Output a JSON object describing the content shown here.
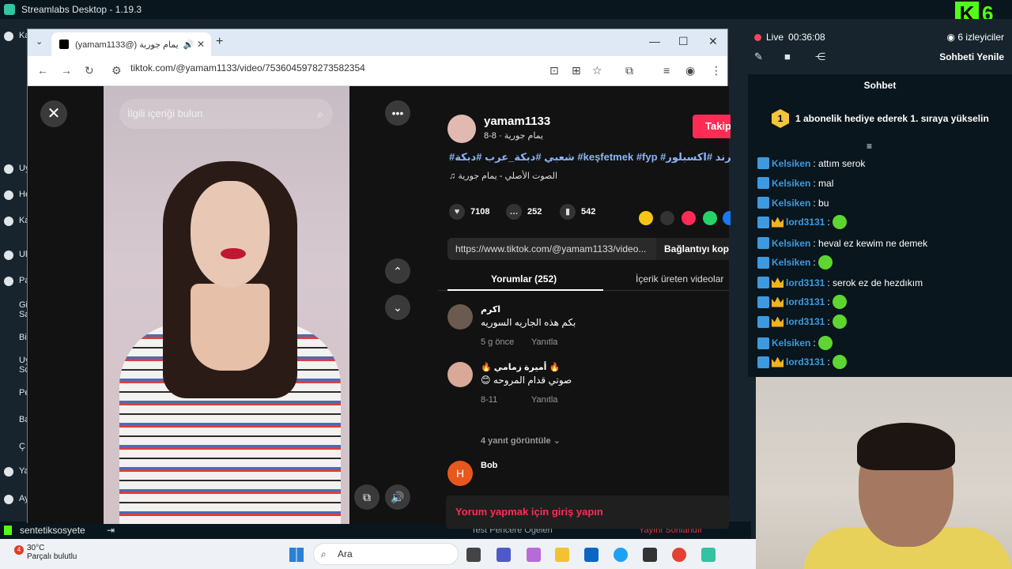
{
  "app_title": "Streamlabs Desktop - 1.19.3",
  "kick_badge": "6",
  "left_nav": [
    "Ka",
    "Uy",
    "He",
    "Ka",
    "Ul",
    "Pa",
    "Gi Sa",
    "Bi",
    "Uy Sc",
    "Pe",
    "Ba",
    "Ç",
    "Ya",
    "Ay"
  ],
  "bottom": {
    "user": "sentetiksosyete",
    "test_windows": "Test Pencere Öğeleri",
    "end_stream": "Yayını Sonlandır"
  },
  "browser": {
    "tab_title": "(yamam1133@) يمام جورية",
    "url": "tiktok.com/@yamam1133/video/7536045978273582354"
  },
  "tiktok": {
    "search_placeholder": "İlgili içeriği bulun",
    "username": "yamam1133",
    "subtitle": "يمام جورية · 8-8",
    "follow": "Takip",
    "hashtags": "#شعبي #دبكة_عرب #دبكة #keşfetmek #fyp #ترند #اكسبلور",
    "sound": "الصوت الأصلي - يمام جورية",
    "likes": "7108",
    "comments_count": "252",
    "saves": "542",
    "link": "https://www.tiktok.com/@yamam1133/video...",
    "copy_link": "Bağlantıyı kopyala",
    "tab_comments": "Yorumlar (252)",
    "tab_creator": "İçerik üreten videolar",
    "comments": [
      {
        "name": "اكرم",
        "text": "بكم هذه الجاريه السوريه",
        "meta": "5 g önce",
        "reply": "Yanıtla"
      },
      {
        "name": "🔥 أميرة زمامي 🔥",
        "text": "😊 صوتي قدام المروحه",
        "meta": "8-11",
        "reply": "Yanıtla"
      },
      {
        "name": "Bob",
        "text": "",
        "meta": "",
        "reply": ""
      }
    ],
    "view_replies": "4 yanıt görüntüle",
    "login_prompt": "Yorum yapmak için giriş yapın"
  },
  "stream": {
    "live_label": "Live",
    "time": "00:36:08",
    "viewers": "6 izleyiciler",
    "refresh_chat": "Sohbeti Yenile",
    "chat_title": "Sohbet",
    "gift_rank": "1",
    "gift_text": "1 abonelik hediye ederek 1. sıraya yükselin",
    "messages": [
      {
        "user": "Kelsiken",
        "text": ": attım serok"
      },
      {
        "user": "Kelsiken",
        "text": ": mal"
      },
      {
        "user": "Kelsiken",
        "text": ": bu"
      },
      {
        "user": "lord3131",
        "text": ":"
      },
      {
        "user": "Kelsiken",
        "text": ": heval ez kewim ne demek"
      },
      {
        "user": "Kelsiken",
        "text": ":"
      },
      {
        "user": "lord3131",
        "text": ": serok ez de hezdıkım"
      },
      {
        "user": "lord3131",
        "text": ":"
      },
      {
        "user": "lord3131",
        "text": ":"
      },
      {
        "user": "Kelsiken",
        "text": ":"
      },
      {
        "user": "lord3131",
        "text": ":"
      }
    ]
  },
  "taskbar": {
    "temp": "30°C",
    "weather": "Parçalı bulutlu",
    "notif": "4",
    "search": "Ara"
  }
}
